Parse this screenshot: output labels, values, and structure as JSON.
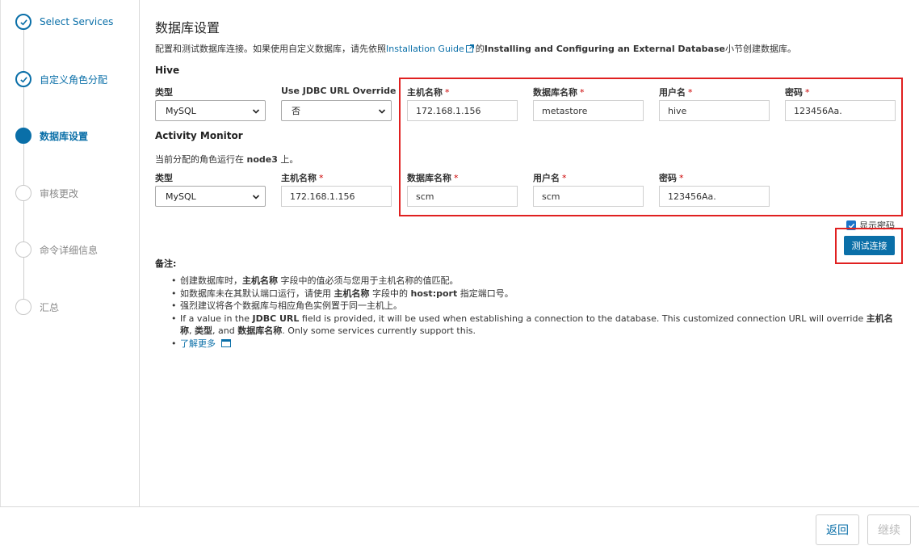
{
  "steps": [
    {
      "label": "Select Services",
      "state": "done"
    },
    {
      "label": "自定义角色分配",
      "state": "done"
    },
    {
      "label": "数据库设置",
      "state": "active"
    },
    {
      "label": "审核更改",
      "state": "pending"
    },
    {
      "label": "命令详细信息",
      "state": "pending"
    },
    {
      "label": "汇总",
      "state": "pending"
    }
  ],
  "page": {
    "title": "数据库设置",
    "intro_prefix": "配置和测试数据库连接。如果使用自定义数据库，请先依照",
    "intro_link": "Installation Guide",
    "intro_mid": "的",
    "intro_bold": "Installing and Configuring an External Database",
    "intro_suffix": "小节创建数据库。"
  },
  "hive": {
    "title": "Hive",
    "type_label": "类型",
    "type_value": "MySQL",
    "jdbc_label": "Use JDBC URL Override",
    "jdbc_value": "否",
    "host_label": "主机名称",
    "host_value": "172.168.1.156",
    "db_label": "数据库名称",
    "db_value": "metastore",
    "user_label": "用户名",
    "user_value": "hive",
    "pass_label": "密码",
    "pass_value": "123456Aa."
  },
  "activity": {
    "title": "Activity Monitor",
    "note_prefix": "当前分配的角色运行在",
    "note_host": "node3",
    "note_suffix": "上。",
    "type_label": "类型",
    "type_value": "MySQL",
    "host_label": "主机名称",
    "host_value": "172.168.1.156",
    "db_label": "数据库名称",
    "db_value": "scm",
    "user_label": "用户名",
    "user_value": "scm",
    "pass_label": "密码",
    "pass_value": "123456Aa."
  },
  "show_password_label": "显示密码",
  "show_password_checked": true,
  "test_button": "测试连接",
  "notes": {
    "title": "备注:",
    "n1_a": "创建数据库时，",
    "n1_b": "主机名称",
    "n1_c": "字段中的值必须与您用于主机名称的值匹配。",
    "n2_a": "如数据库未在其默认端口运行，请使用",
    "n2_b": "主机名称",
    "n2_c": "字段中的",
    "n2_d": "host:port",
    "n2_e": "指定端口号。",
    "n3": "强烈建议将各个数据库与相应角色实例置于同一主机上。",
    "n4_a": "If a value in the",
    "n4_b": "JDBC URL",
    "n4_c": "field is provided, it will be used when establishing a connection to the database. This customized connection URL will override",
    "n4_d": "主机名称",
    "n4_e": ",",
    "n4_f": "类型",
    "n4_g": ", and",
    "n4_h": "数据库名称",
    "n4_i": ". Only some services currently support this.",
    "learn_more": "了解更多"
  },
  "footer": {
    "back": "返回",
    "next": "继续"
  },
  "colors": {
    "accent": "#0a6fa8",
    "highlight": "#e02020",
    "required": "#cc0000"
  }
}
